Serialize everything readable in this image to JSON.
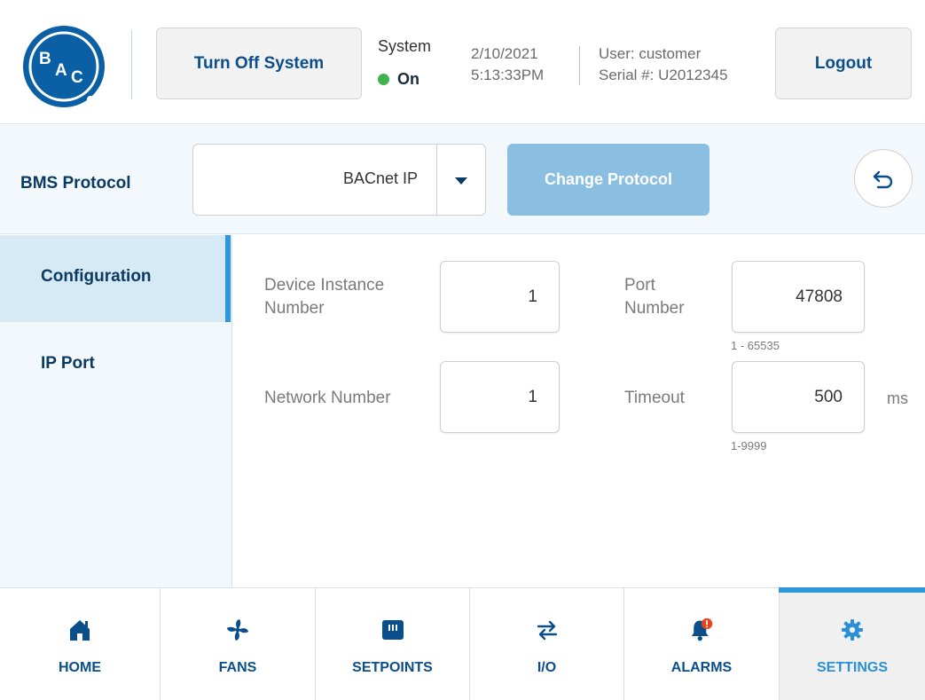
{
  "header": {
    "logo_text": "BAC",
    "turn_off_label": "Turn Off System",
    "system_label": "System",
    "system_status": "On",
    "date": "2/10/2021",
    "time": "5:13:33PM",
    "user": "User: customer",
    "serial": "Serial #: U2012345",
    "logout_label": "Logout"
  },
  "protocol": {
    "label": "BMS Protocol",
    "selected": "BACnet IP",
    "change_label": "Change Protocol"
  },
  "sidebar": {
    "items": [
      {
        "label": "Configuration",
        "active": true
      },
      {
        "label": "IP Port",
        "active": false
      }
    ]
  },
  "fields": {
    "device_instance": {
      "label": "Device Instance Number",
      "value": "1"
    },
    "network_number": {
      "label": "Network Number",
      "value": "1"
    },
    "port_number": {
      "label": "Port Number",
      "value": "47808",
      "hint": "1 - 65535"
    },
    "timeout": {
      "label": "Timeout",
      "value": "500",
      "unit": "ms",
      "hint": "1-9999"
    }
  },
  "nav": {
    "items": [
      {
        "label": "HOME",
        "icon": "home-icon"
      },
      {
        "label": "FANS",
        "icon": "fan-icon"
      },
      {
        "label": "SETPOINTS",
        "icon": "setpoints-icon"
      },
      {
        "label": "I/O",
        "icon": "io-arrows-icon"
      },
      {
        "label": "ALARMS",
        "icon": "bell-alert-icon"
      },
      {
        "label": "SETTINGS",
        "icon": "gear-icon",
        "active": true
      }
    ]
  },
  "colors": {
    "brand_blue": "#0b4f8a",
    "accent_blue": "#2f98dd",
    "status_on": "#3fb34f",
    "alarm_badge": "#e8431c"
  }
}
